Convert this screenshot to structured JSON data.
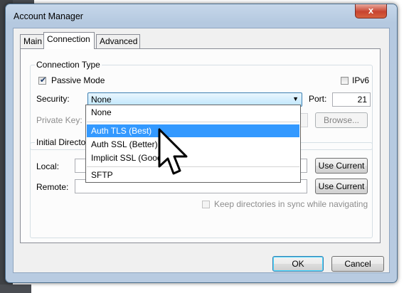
{
  "window": {
    "title": "Account Manager",
    "close_glyph": "x"
  },
  "tabs": [
    {
      "label": "Main"
    },
    {
      "label": "Connection",
      "active": true
    },
    {
      "label": "Advanced"
    }
  ],
  "connection_type": {
    "legend": "Connection Type",
    "passive_mode": {
      "label": "Passive Mode",
      "checked": true
    },
    "ipv6": {
      "label": "IPv6",
      "checked": false
    },
    "security": {
      "label": "Security:",
      "value": "None"
    },
    "port": {
      "label": "Port:",
      "value": "21"
    },
    "private_key": {
      "label": "Private Key:",
      "value": ""
    },
    "browse_label": "Browse..."
  },
  "security_dropdown": {
    "options": [
      {
        "label": "None",
        "selected": false
      },
      {
        "label": "Auth TLS (Best)",
        "selected": true
      },
      {
        "label": "Auth SSL (Better)",
        "selected": false
      },
      {
        "label": "Implicit SSL (Good)",
        "selected": false
      },
      {
        "label": "SFTP",
        "selected": false
      }
    ]
  },
  "initial_directory": {
    "legend": "Initial Directory",
    "local": {
      "label": "Local:",
      "value": ""
    },
    "remote": {
      "label": "Remote:",
      "value": ""
    },
    "use_current_label": "Use Current",
    "sync": {
      "label": "Keep directories in sync while navigating",
      "checked": false,
      "enabled": false
    }
  },
  "footer": {
    "ok_label": "OK",
    "cancel_label": "Cancel"
  },
  "colors": {
    "selection": "#3399ff",
    "title_bar": "#b8cbe1",
    "close_button": "#c7432f"
  },
  "icons": [
    "close-icon",
    "dropdown-arrow-icon",
    "check-icon",
    "mouse-pointer-icon"
  ]
}
